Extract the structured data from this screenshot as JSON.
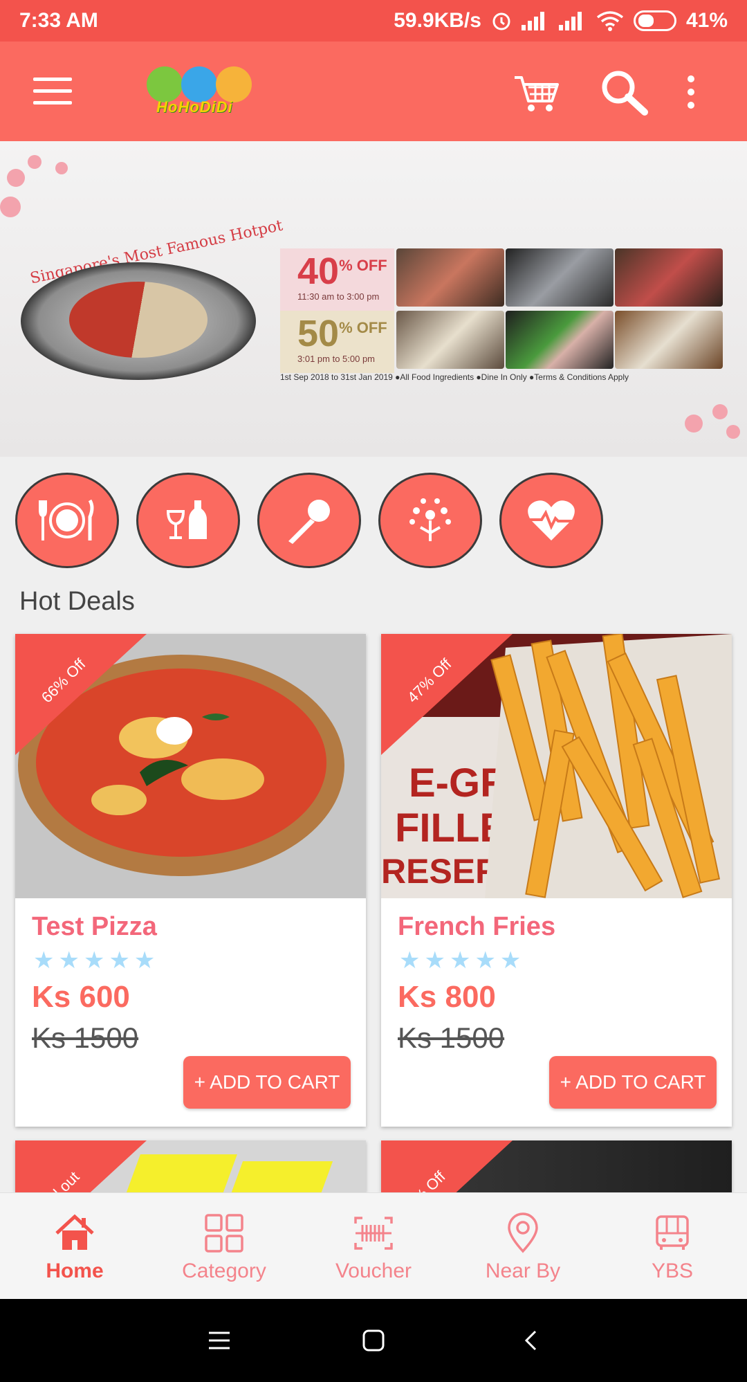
{
  "status_bar": {
    "time": "7:33 AM",
    "speed": "59.9KB/s",
    "battery": "41%"
  },
  "app_bar": {
    "logo_text": "HoHoDiDi"
  },
  "banner": {
    "headline": "Singapore's Most Famous Hotpot",
    "promo1_pct": "40",
    "promo1_unit": "% OFF",
    "promo1_time": "11:30 am to 3:00 pm",
    "promo2_pct": "50",
    "promo2_unit": "% OFF",
    "promo2_time": "3:01 pm to 5:00 pm",
    "note": "1st Sep 2018 to 31st Jan 2019 ●All Food Ingredients ●Dine In Only ●Terms & Conditions Apply"
  },
  "section": {
    "title": "Hot Deals"
  },
  "deals": [
    {
      "badge": "66% Off",
      "title": "Test Pizza",
      "rating": 5,
      "stars": "★★★★★",
      "price": "Ks 600",
      "old_price": "Ks 1500",
      "button": "+ ADD TO CART"
    },
    {
      "badge": "47% Off",
      "title": "French Fries",
      "rating": 5,
      "stars": "★★★★★",
      "price": "Ks 800",
      "old_price": "Ks 1500",
      "button": "+ ADD TO CART"
    },
    {
      "badge": "ld out"
    },
    {
      "badge": "% Off"
    }
  ],
  "bottom_nav": [
    {
      "label": "Home",
      "icon": "home-icon"
    },
    {
      "label": "Category",
      "icon": "grid-icon"
    },
    {
      "label": "Voucher",
      "icon": "voucher-icon"
    },
    {
      "label": "Near By",
      "icon": "location-pin-icon"
    },
    {
      "label": "YBS",
      "icon": "bus-icon"
    }
  ],
  "colors": {
    "status_bar": "#f3534c",
    "app_bar": "#fb6a60",
    "accent": "#fb6a60",
    "title": "#f3677a",
    "stars": "#a8dcfa"
  }
}
